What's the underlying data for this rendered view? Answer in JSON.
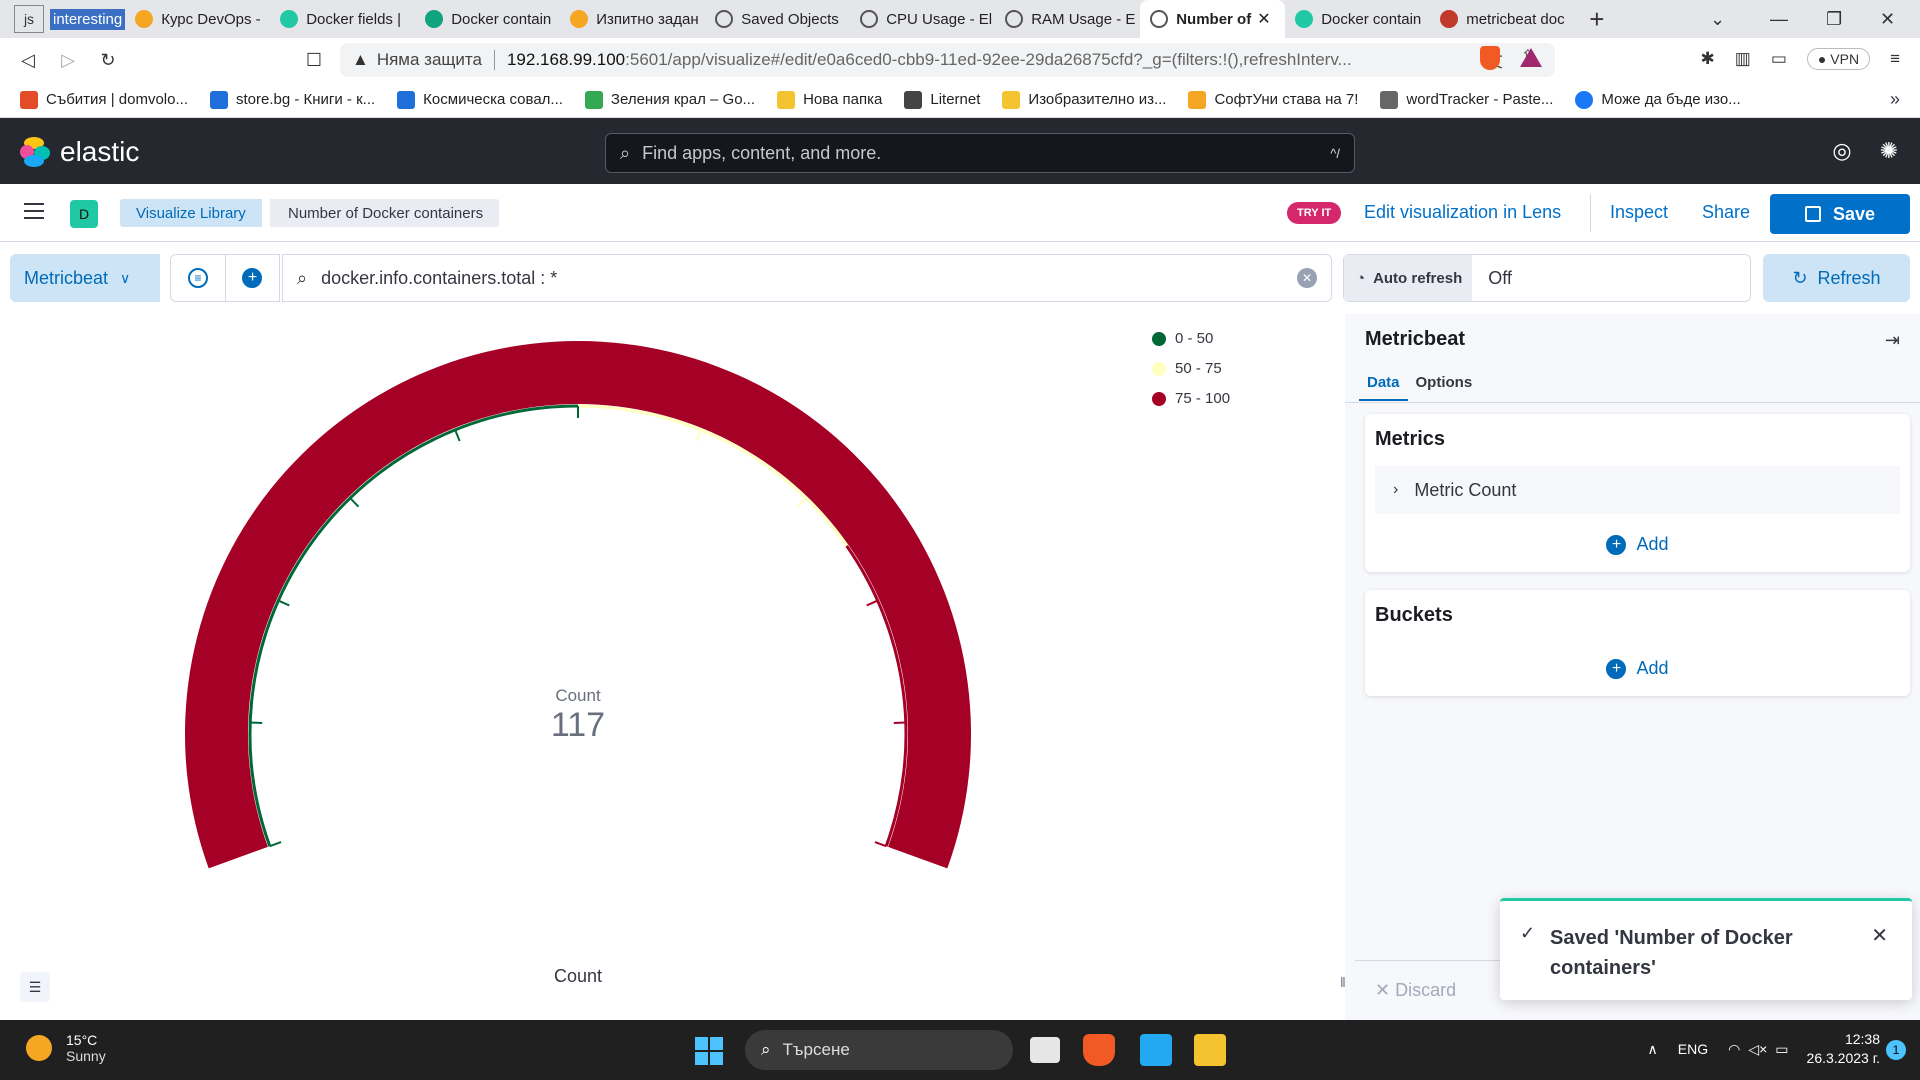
{
  "browser": {
    "tabs": [
      {
        "label": "js"
      },
      {
        "label": "interesting"
      },
      {
        "label": "Курс DevOps -"
      },
      {
        "label": "Docker fields |"
      },
      {
        "label": "Docker contain"
      },
      {
        "label": "Изпитно задан"
      },
      {
        "label": "Saved Objects"
      },
      {
        "label": "CPU Usage - El"
      },
      {
        "label": "RAM Usage - E"
      },
      {
        "label": "Number of"
      },
      {
        "label": "Docker contain"
      },
      {
        "label": "metricbeat doc"
      }
    ],
    "address": {
      "security": "Няма защита",
      "host": "192.168.99.100",
      "path": ":5601/app/visualize#/edit/e0a6ced0-cbb9-11ed-92ee-29da26875cfd?_g=(filters:!(),refreshInterv..."
    },
    "vpn_label": "VPN",
    "bookmarks": [
      {
        "label": "Събития | domvolo...",
        "color": "#e34c26"
      },
      {
        "label": "store.bg - Книги - к...",
        "color": "#1e6fd9"
      },
      {
        "label": "Космическа совал...",
        "color": "#1e6fd9"
      },
      {
        "label": "Зеления крал – Go...",
        "color": "#34a853"
      },
      {
        "label": "Нова папка",
        "color": "#f4c430"
      },
      {
        "label": "Liternet",
        "color": "#444444"
      },
      {
        "label": "Изобразително из...",
        "color": "#f4c430"
      },
      {
        "label": "СофтУни става на 7!",
        "color": "#f5a623"
      },
      {
        "label": "wordTracker - Paste...",
        "color": "#666666"
      },
      {
        "label": "Може да бъде изо...",
        "color": "#1877f2"
      }
    ]
  },
  "kibana": {
    "brand": "elastic",
    "search_placeholder": "Find apps, content, and more.",
    "search_shortcut": "^/",
    "space_initial": "D",
    "breadcrumbs": [
      "Visualize Library",
      "Number of Docker containers"
    ],
    "try_it": "TRY IT",
    "lens_link": "Edit visualization in Lens",
    "inspect": "Inspect",
    "share": "Share",
    "save": "Save",
    "data_view": "Metricbeat",
    "query": "docker.info.containers.total : *",
    "auto_refresh_label": "Auto refresh",
    "auto_refresh_value": "Off",
    "refresh": "Refresh"
  },
  "gauge": {
    "label": "Count",
    "value": "117",
    "sublabel": "Count",
    "fill_percent": 100,
    "legend": [
      {
        "label": "0 - 50",
        "color": "#006837"
      },
      {
        "label": "50 - 75",
        "color": "#ffffbf"
      },
      {
        "label": "75 - 100",
        "color": "#a50026"
      }
    ]
  },
  "sidebar": {
    "title": "Metricbeat",
    "tabs": [
      "Data",
      "Options"
    ],
    "metrics_title": "Metrics",
    "metric_item": "Metric Count",
    "add_label": "Add",
    "buckets_title": "Buckets",
    "discard": "Discard"
  },
  "toast": {
    "message": "Saved 'Number of Docker containers'"
  },
  "taskbar": {
    "temp": "15°C",
    "weather": "Sunny",
    "search": "Търсене",
    "lang": "ENG",
    "time": "12:38",
    "date": "26.3.2023 г.",
    "notifications": "1"
  }
}
